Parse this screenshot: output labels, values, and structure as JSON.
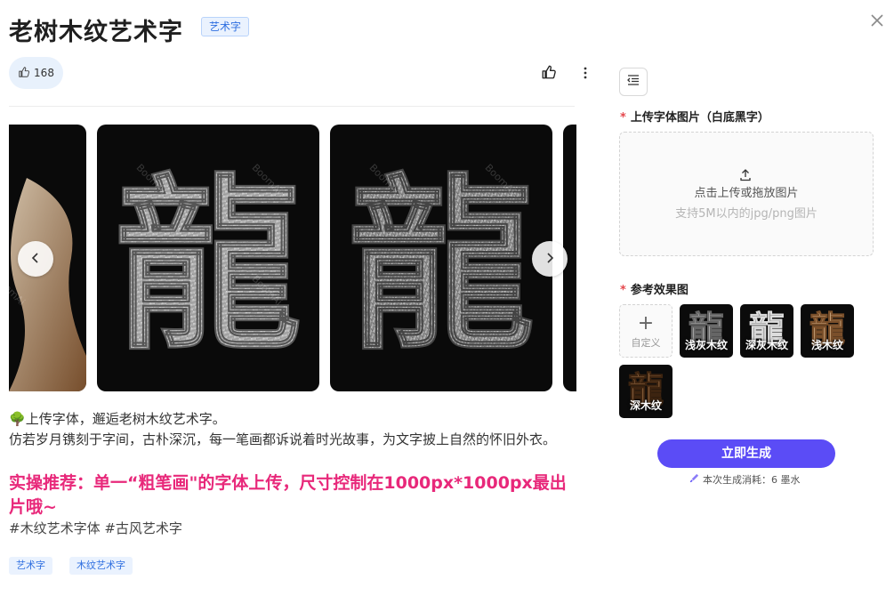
{
  "header": {
    "title": "老树木纹艺术字",
    "tag": "艺术字",
    "close_icon": "close-icon"
  },
  "toolbar": {
    "like_count": "168",
    "like_icon": "thumbs-up-icon",
    "thumb_icon": "thumbs-up-icon",
    "more_icon": "more-vertical-icon"
  },
  "carousel": {
    "watermark": "BoomAi",
    "glyph": "龍",
    "prev_icon": "chevron-left-icon",
    "next_icon": "chevron-right-icon"
  },
  "description": {
    "emoji": "🌳",
    "line1": "上传字体，邂逅老树木纹艺术字。",
    "line2": "仿若岁月镌刻于字间，古朴深沉，每一笔画都诉说着时光故事，为文字披上自然的怀旧外衣。",
    "highlight": "实操推荐：单一“粗笔画\"的字体上传，尺寸控制在1000px*1000px最出片哦~",
    "hashtags": "#木纹艺术字体 #古风艺术字"
  },
  "tags": [
    "艺术字",
    "木纹艺术字"
  ],
  "sidebar": {
    "toggle_icon": "collapse-sidebar-icon",
    "upload_label": "上传字体图片（白底黑字）",
    "required_mark": "*",
    "upload_icon": "upload-icon",
    "upload_text": "点击上传或拖放图片",
    "upload_hint": "支持5M以内的jpg/png图片",
    "reference_label": "参考效果图",
    "custom_plus": "+",
    "custom_label": "自定义",
    "references": [
      "浅灰木纹",
      "深灰木纹",
      "浅木纹",
      "深木纹"
    ],
    "generate_label": "立即生成",
    "cost_icon": "ink-brush-icon",
    "cost_text": "本次生成消耗：6 墨水"
  },
  "colors": {
    "accent": "#5b4cf6",
    "highlight": "#e8287a",
    "tag_blue": "#2f6fe0",
    "required": "#e5484d"
  }
}
